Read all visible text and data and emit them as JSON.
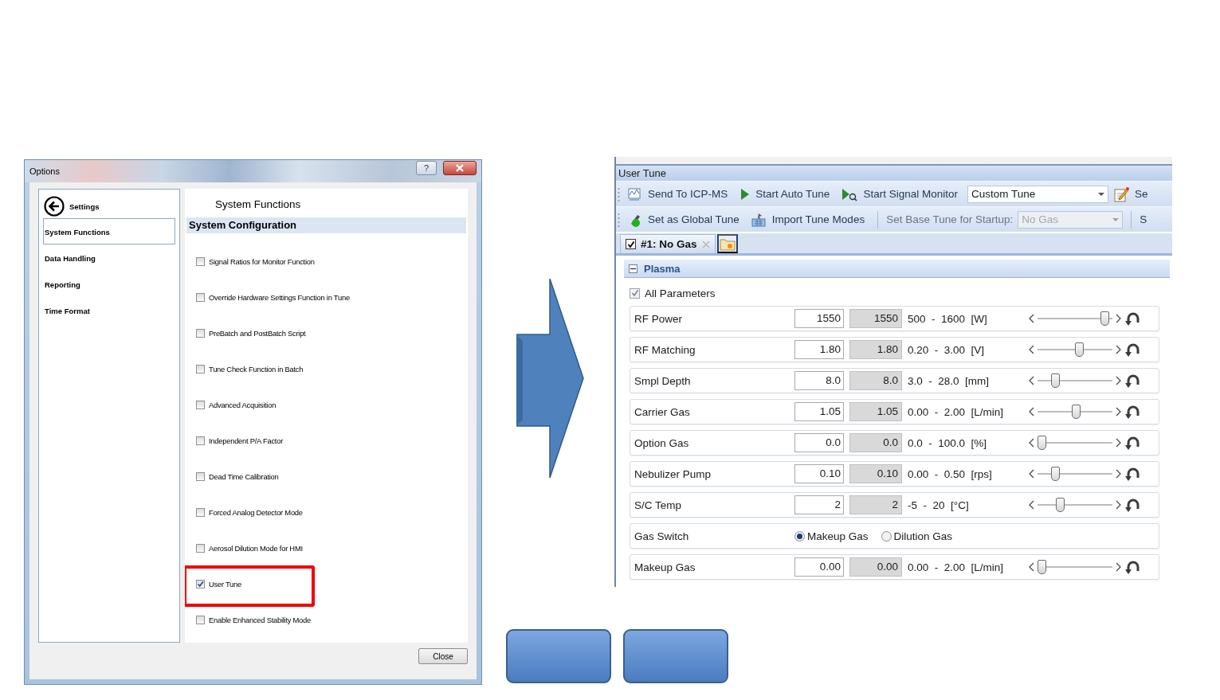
{
  "options_dialog": {
    "title": "Options",
    "help_glyph": "?",
    "back_label": "Settings",
    "nav": [
      {
        "label": "System Functions",
        "selected": true
      },
      {
        "label": "Data Handling",
        "selected": false
      },
      {
        "label": "Reporting",
        "selected": false
      },
      {
        "label": "Time Format",
        "selected": false
      }
    ],
    "page_title": "System Functions",
    "section": "System Configuration",
    "options": [
      {
        "label": "Signal Ratios for Monitor Function",
        "checked": false,
        "highlighted": false
      },
      {
        "label": "Override Hardware Settings Function in Tune",
        "checked": false,
        "highlighted": false
      },
      {
        "label": "PreBatch and PostBatch Script",
        "checked": false,
        "highlighted": false
      },
      {
        "label": "Tune Check Function in Batch",
        "checked": false,
        "highlighted": false
      },
      {
        "label": "Advanced Acquisition",
        "checked": false,
        "highlighted": false
      },
      {
        "label": "Independent P/A Factor",
        "checked": false,
        "highlighted": false
      },
      {
        "label": "Dead Time Calibration",
        "checked": false,
        "highlighted": false
      },
      {
        "label": "Forced Analog Detector Mode",
        "checked": false,
        "highlighted": false
      },
      {
        "label": "Aerosol Dilution Mode for HMI",
        "checked": false,
        "highlighted": false
      },
      {
        "label": "User Tune",
        "checked": true,
        "highlighted": true
      },
      {
        "label": "Enable Enhanced Stability Mode",
        "checked": false,
        "highlighted": false
      }
    ],
    "close_button": "Close"
  },
  "tune_panel": {
    "title": "User Tune",
    "toolbar_1": [
      {
        "kind": "button",
        "label": "Send To ICP-MS"
      },
      {
        "kind": "button",
        "label": "Start Auto Tune"
      },
      {
        "kind": "button",
        "label": "Start Signal Monitor"
      },
      {
        "kind": "dropdown",
        "value": "Custom Tune",
        "disabled": false
      },
      {
        "kind": "icon_button"
      },
      {
        "kind": "overflow",
        "label": "Se"
      }
    ],
    "toolbar_2": [
      {
        "kind": "button",
        "label": "Set as Global Tune"
      },
      {
        "kind": "button",
        "label": "Import Tune Modes"
      },
      {
        "kind": "separator"
      },
      {
        "kind": "label",
        "label": "Set Base Tune for Startup:"
      },
      {
        "kind": "dropdown",
        "value": "No Gas",
        "disabled": true
      },
      {
        "kind": "separator"
      },
      {
        "kind": "overflow",
        "label": "S"
      }
    ],
    "tab": {
      "label": "#1: No Gas",
      "checked": true,
      "selected": true
    },
    "group": {
      "label": "Plasma",
      "expanded": true
    },
    "all_parameters": {
      "label": "All Parameters",
      "checked": true
    },
    "params": [
      {
        "kind": "slider",
        "label": "RF Power",
        "value": "1550",
        "current": "1550",
        "range": "500  -  1600  [W]",
        "level": 0.95
      },
      {
        "kind": "slider",
        "label": "RF Matching",
        "value": "1.80",
        "current": "1.80",
        "range": "0.20  -  3.00  [V]",
        "level": 0.57
      },
      {
        "kind": "slider",
        "label": "Smpl Depth",
        "value": "8.0",
        "current": "8.0",
        "range": "3.0  -  28.0  [mm]",
        "level": 0.2
      },
      {
        "kind": "slider",
        "label": "Carrier Gas",
        "value": "1.05",
        "current": "1.05",
        "range": "0.00  -  2.00  [L/min]",
        "level": 0.52
      },
      {
        "kind": "slider",
        "label": "Option Gas",
        "value": "0.0",
        "current": "0.0",
        "range": "0.0  -  100.0  [%]",
        "level": 0
      },
      {
        "kind": "slider",
        "label": "Nebulizer Pump",
        "value": "0.10",
        "current": "0.10",
        "range": "0.00  -  0.50  [rps]",
        "level": 0.2
      },
      {
        "kind": "slider",
        "label": "S/C Temp",
        "value": "2",
        "current": "2",
        "range": "-5  -  20  [°C]",
        "level": 0.28
      },
      {
        "kind": "radio",
        "label": "Gas Switch",
        "options": [
          {
            "label": "Makeup Gas",
            "selected": true
          },
          {
            "label": "Dilution Gas",
            "selected": false
          }
        ]
      },
      {
        "kind": "slider",
        "label": "Makeup Gas",
        "value": "0.00",
        "current": "0.00",
        "range": "0.00  -  2.00  [L/min]",
        "level": 0
      }
    ]
  }
}
